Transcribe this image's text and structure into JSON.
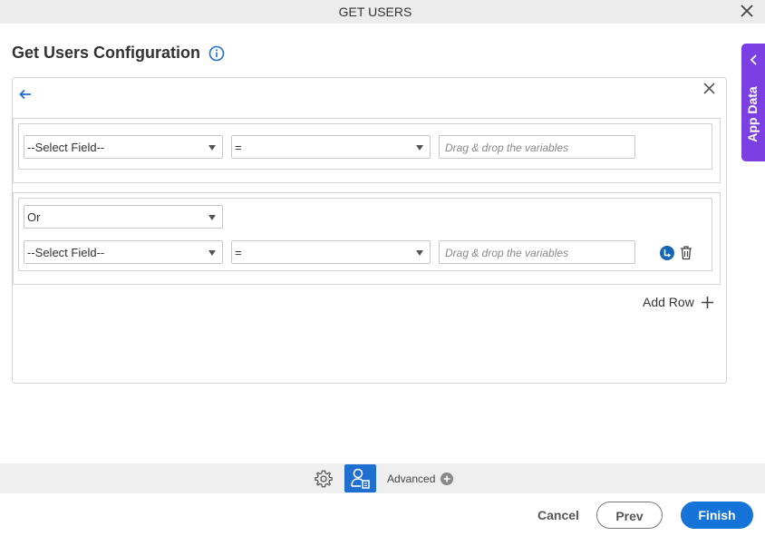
{
  "window": {
    "title": "GET USERS"
  },
  "page": {
    "heading": "Get Users Configuration"
  },
  "condition_1": {
    "field": "--Select Field--",
    "operator": "=",
    "value_placeholder": "Drag & drop the variables"
  },
  "condition_2": {
    "logic": "Or",
    "field": "--Select Field--",
    "operator": "=",
    "value_placeholder": "Drag & drop the variables"
  },
  "add_row_label": "Add Row",
  "side_panel": {
    "label": "App Data"
  },
  "toolbar": {
    "advanced_label": "Advanced"
  },
  "footer": {
    "cancel": "Cancel",
    "prev": "Prev",
    "finish": "Finish"
  },
  "colors": {
    "accent": "#1673d8",
    "side_panel": "#7b3fe4",
    "info_icon": "#1e6fd0"
  }
}
